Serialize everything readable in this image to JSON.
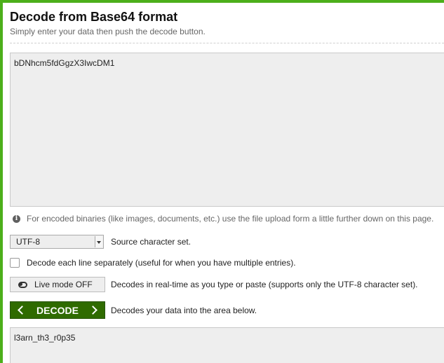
{
  "header": {
    "title": "Decode from Base64 format",
    "subtitle": "Simply enter your data then push the decode button."
  },
  "input": {
    "value": "bDNhcm5fdGgzX3IwcDM1"
  },
  "note": {
    "icon": "info-icon",
    "text": "For encoded binaries (like images, documents, etc.) use the file upload form a little further down on this page."
  },
  "charset": {
    "selected": "UTF-8",
    "label": "Source character set."
  },
  "line_option": {
    "checked": false,
    "label": "Decode each line separately (useful for when you have multiple entries)."
  },
  "live_mode": {
    "button_label": "Live mode OFF",
    "description": "Decodes in real-time as you type or paste (supports only the UTF-8 character set)."
  },
  "decode": {
    "button_label": "DECODE",
    "description": "Decodes your data into the area below."
  },
  "output": {
    "value": "l3arn_th3_r0p35"
  },
  "colors": {
    "accent_green": "#4caf1a",
    "decode_button": "#2f6b00"
  }
}
